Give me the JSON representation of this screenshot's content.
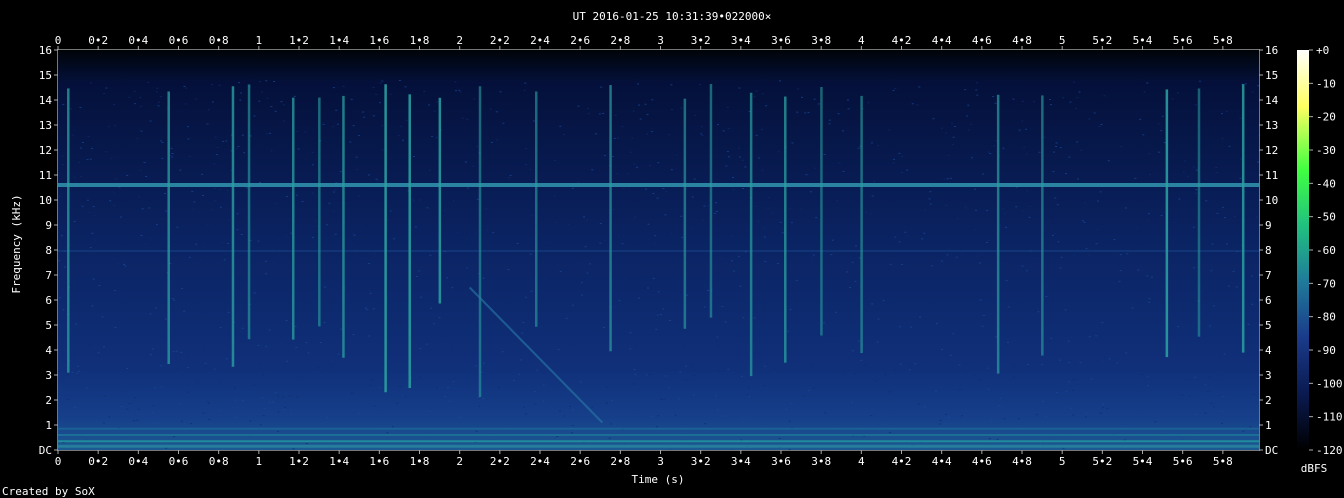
{
  "chart_data": {
    "type": "heatmap",
    "title": "UT 2016-01-25 10:31:39•022000×",
    "xlabel": "Time (s)",
    "ylabel": "Frequency (kHz)",
    "footer": "Created by SoX",
    "xlim": [
      0,
      5.98
    ],
    "ylim": [
      0,
      16
    ],
    "x_ticks": [
      "0",
      "0•2",
      "0•4",
      "0•6",
      "0•8",
      "1",
      "1•2",
      "1•4",
      "1•6",
      "1•8",
      "2",
      "2•2",
      "2•4",
      "2•6",
      "2•8",
      "3",
      "3•2",
      "3•4",
      "3•6",
      "3•8",
      "4",
      "4•2",
      "4•4",
      "4•6",
      "4•8",
      "5",
      "5•2",
      "5•4",
      "5•6",
      "5•8"
    ],
    "x_tick_values": [
      0,
      0.2,
      0.4,
      0.6,
      0.8,
      1,
      1.2,
      1.4,
      1.6,
      1.8,
      2,
      2.2,
      2.4,
      2.6,
      2.8,
      3,
      3.2,
      3.4,
      3.6,
      3.8,
      4,
      4.2,
      4.4,
      4.6,
      4.8,
      5,
      5.2,
      5.4,
      5.6,
      5.8
    ],
    "y_ticks": [
      "DC",
      "1",
      "2",
      "3",
      "4",
      "5",
      "6",
      "7",
      "8",
      "9",
      "10",
      "11",
      "12",
      "13",
      "14",
      "15",
      "16"
    ],
    "colorbar": {
      "label": "dBFS",
      "range": [
        -120,
        0
      ],
      "ticks": [
        "+0",
        "-10",
        "-20",
        "-30",
        "-40",
        "-50",
        "-60",
        "-70",
        "-80",
        "-90",
        "-100",
        "-110",
        "-120"
      ]
    },
    "features": {
      "tone_lines_khz": [
        10.6,
        7.9
      ],
      "transients_s": [
        0.05,
        0.55,
        0.87,
        0.95,
        1.17,
        1.3,
        1.42,
        1.63,
        1.75,
        1.9,
        2.1,
        2.38,
        2.75,
        3.12,
        3.25,
        3.45,
        3.62,
        3.8,
        4.0,
        4.68,
        4.9,
        5.52,
        5.68,
        5.9
      ],
      "noise_floor_dbfs": -100,
      "strong_low_band_khz": [
        0,
        1
      ]
    },
    "colors": [
      "#000000",
      "#0a1a50",
      "#1a3a8a",
      "#1f7a9a",
      "#20c080",
      "#40ff40",
      "#ffff60",
      "#ffffff"
    ]
  }
}
